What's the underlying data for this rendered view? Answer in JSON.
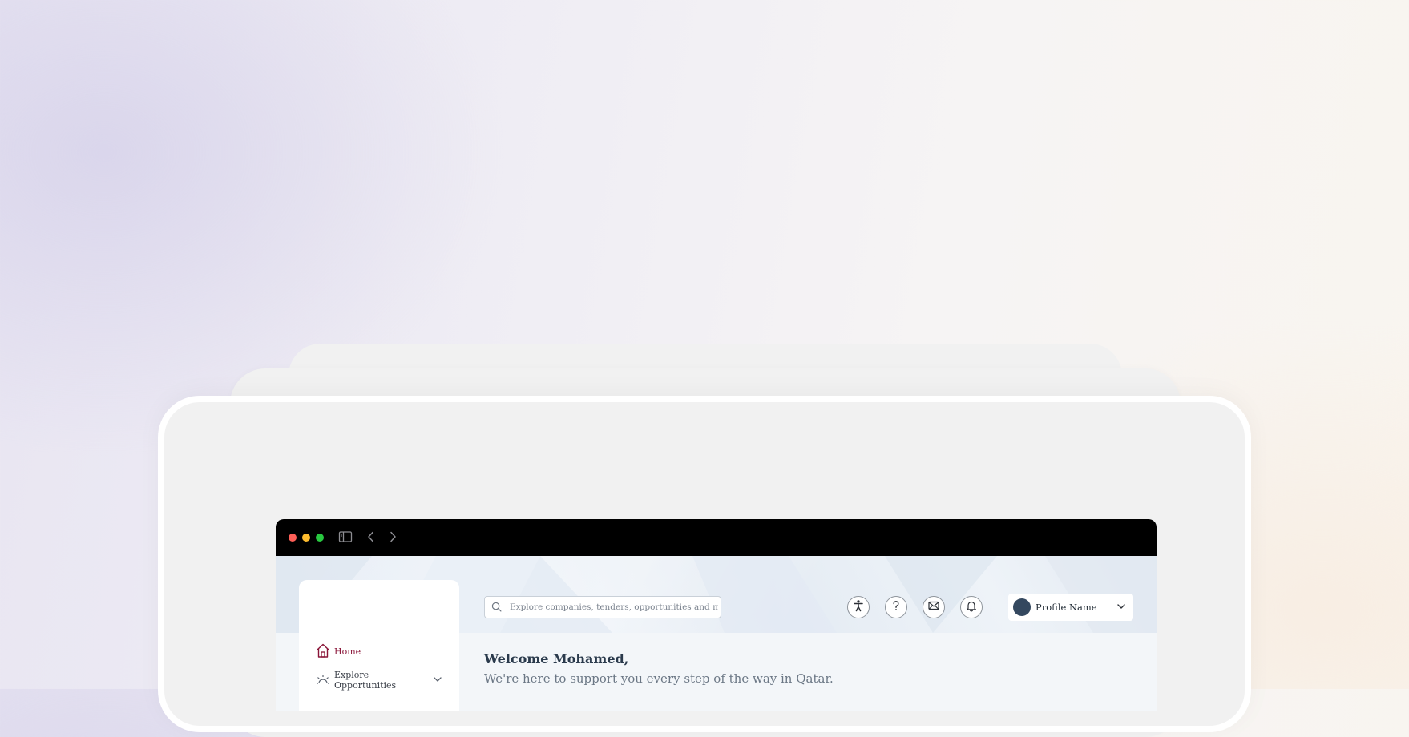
{
  "browser": {
    "traffic_lights": {
      "close_color": "#fe5f57",
      "minimize_color": "#febc2e",
      "maximize_color": "#28c840"
    },
    "toolbar_icons": [
      "sidebar-toggle-icon",
      "back-arrow-icon",
      "forward-arrow-icon"
    ]
  },
  "sidebar": {
    "items": [
      {
        "label": "Home",
        "icon": "home-icon",
        "active": true,
        "color": "#8a1538"
      },
      {
        "label": "Explore Opportunities",
        "icon": "sunrise-icon",
        "has_submenu": true
      }
    ]
  },
  "search": {
    "placeholder": "Explore companies, tenders, opportunities and more"
  },
  "header_actions": [
    "accessibility-icon",
    "help-icon",
    "mail-icon",
    "bell-icon"
  ],
  "profile": {
    "name": "Profile Name",
    "avatar_color": "#34485f"
  },
  "main": {
    "welcome": "Welcome Mohamed,",
    "subtitle": "We're here to support you every step of the way in Qatar."
  }
}
